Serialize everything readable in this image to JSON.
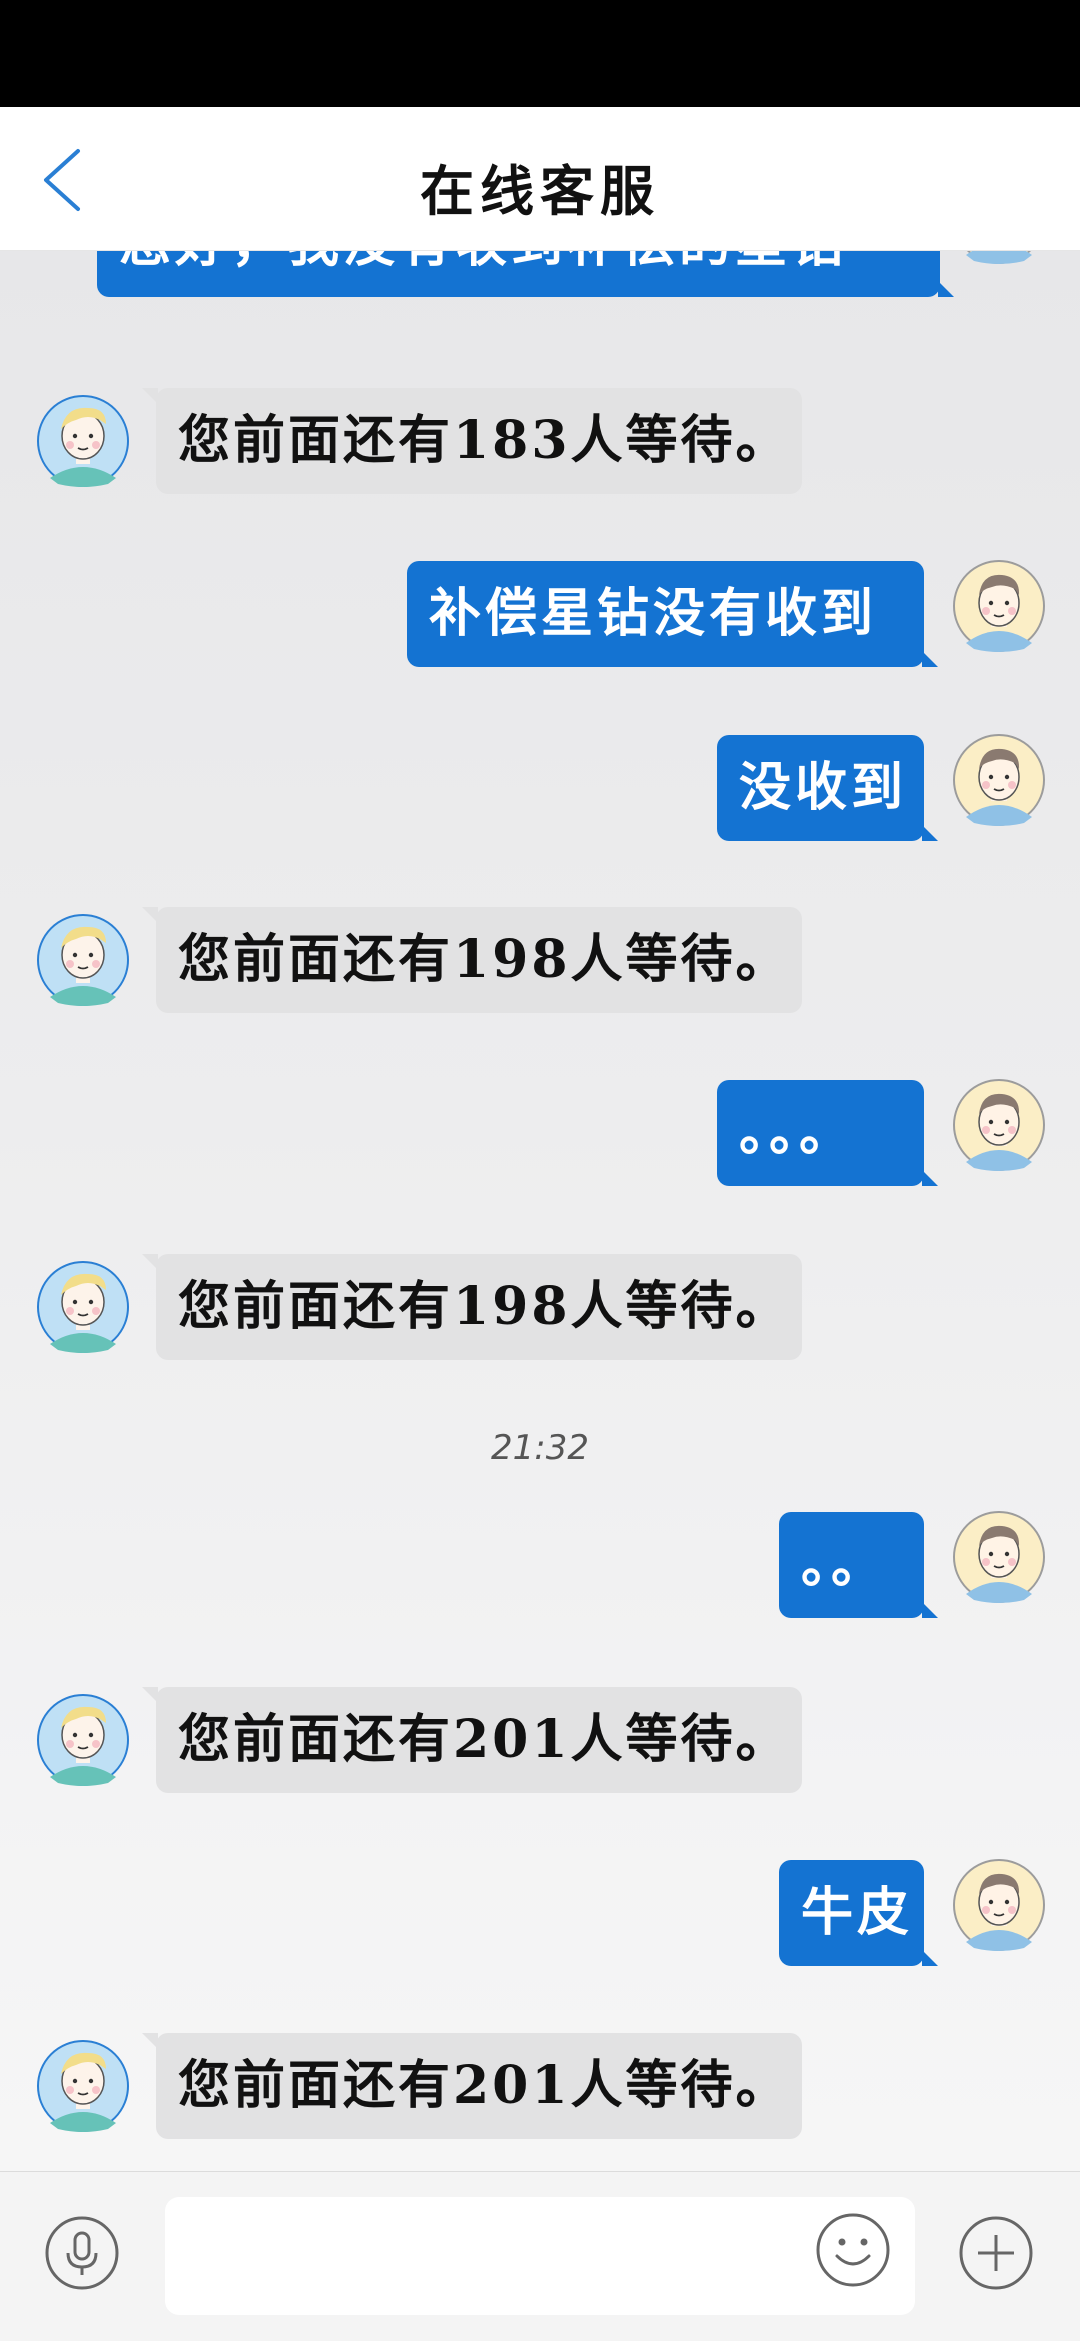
{
  "header": {
    "title": "在线客服",
    "back_icon": "chevron-left-icon"
  },
  "colors": {
    "accent": "#1473d2",
    "incoming_bubble": "#e2e2e3",
    "header_bg": "#ffffff",
    "status_bar": "#000000"
  },
  "messages": [
    {
      "from": "user",
      "text": "您好，我没有收到补偿的星钻"
    },
    {
      "from": "agent",
      "text": "您前面还有183人等待。"
    },
    {
      "from": "user",
      "text": "补偿星钻没有收到"
    },
    {
      "from": "user",
      "text": "没收到"
    },
    {
      "from": "agent",
      "text": "您前面还有198人等待。"
    },
    {
      "from": "user",
      "text": "。。。"
    },
    {
      "from": "agent",
      "text": "您前面还有198人等待。"
    },
    {
      "from": "user",
      "text": "。。"
    },
    {
      "from": "agent",
      "text": "您前面还有201人等待。"
    },
    {
      "from": "user",
      "text": "牛皮"
    },
    {
      "from": "agent",
      "text": "您前面还有201人等待。"
    }
  ],
  "timestamp": "21:32",
  "input_bar": {
    "message_value": "",
    "voice_icon": "microphone-icon",
    "emoji_icon": "smiley-icon",
    "more_icon": "plus-icon"
  }
}
